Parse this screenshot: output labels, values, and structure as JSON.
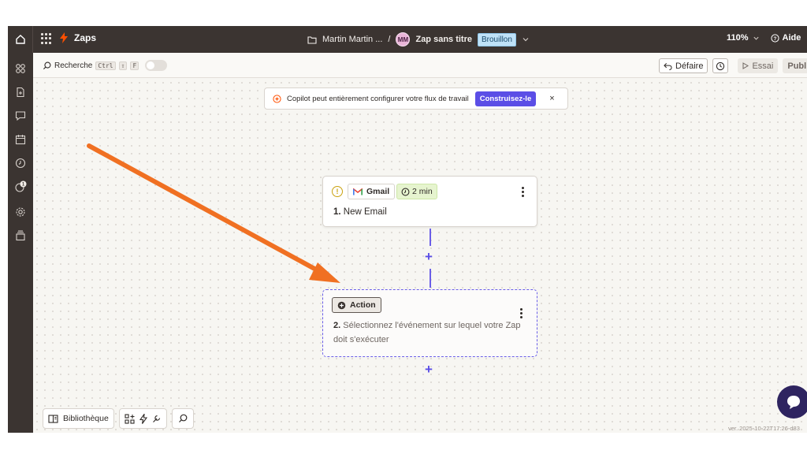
{
  "topbar": {
    "app_name": "Zaps",
    "breadcrumb_folder": "Martin Martin ...",
    "breadcrumb_sep": "/",
    "avatar_initials": "MM",
    "zap_title": "Zap sans titre",
    "status_badge": "Brouillon",
    "zoom": "110%",
    "help": "Aide"
  },
  "sidebar": {
    "items": [
      "grid-icon",
      "file-add-icon",
      "chat-icon",
      "calendar-icon",
      "clock-icon",
      "history-icon",
      "settings-icon",
      "layers-icon"
    ],
    "badge_count": "1"
  },
  "toolbar": {
    "search_label": "Recherche",
    "shortcut_ctrl": "Ctrl",
    "shortcut_shift": "⇧",
    "shortcut_key": "F",
    "undo_label": "Défaire",
    "test_label": "Essai",
    "publish_label": "Publi"
  },
  "copilot_banner": {
    "text": "Copilot peut entièrement configurer votre flux de travail",
    "button": "Construisez-le",
    "close": "×"
  },
  "steps": [
    {
      "app": "Gmail",
      "time": "2 min",
      "number": "1.",
      "title": "New Email"
    },
    {
      "chip": "Action",
      "number": "2.",
      "title": "Sélectionnez l'événement sur lequel votre Zap doit s'exécuter"
    }
  ],
  "bottom_tools": {
    "library": "Bibliothèque"
  },
  "version": "ver. 2025-10-22T17:26-d83",
  "colors": {
    "dark_bar": "#3b3431",
    "accent": "#5b4ee6",
    "arrow": "#f07022",
    "brand": "#ff4f00"
  }
}
